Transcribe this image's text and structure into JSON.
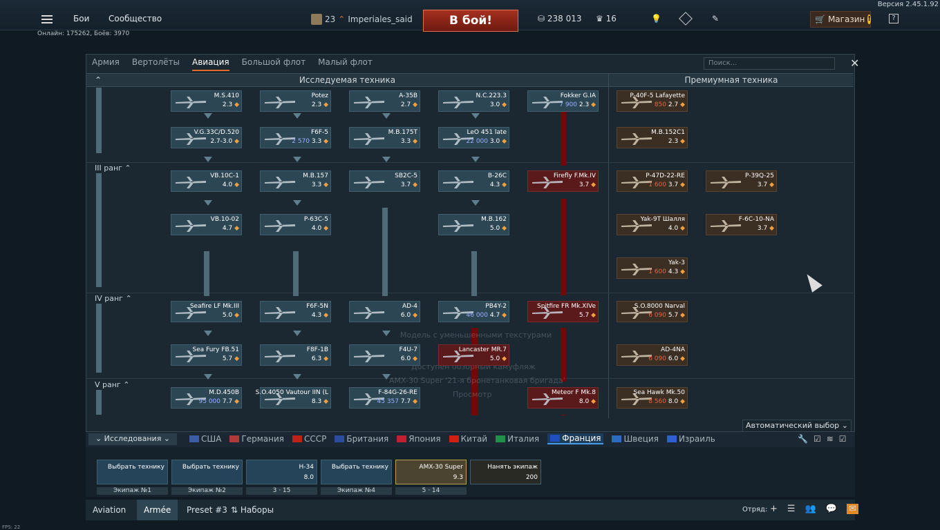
{
  "version": "Версия 2.45.1.92",
  "top": {
    "battles": "Бои",
    "community": "Сообщество",
    "player_level": "23",
    "player_name": "Imperiales_said",
    "fight_button": "В бой!",
    "silver_lions": "238 013",
    "gold_eagles": "16",
    "shop": "Магазин",
    "help": "?"
  },
  "online_info": "Онлайн: 175262, Боёв: 3970",
  "tabs": [
    "Армия",
    "Вертолёты",
    "Авиация",
    "Большой флот",
    "Малый флот"
  ],
  "search_placeholder": "Поиск...",
  "sections": {
    "researchable": "Исследуемая техника",
    "premium": "Премиумная техника"
  },
  "ranks": {
    "r3": "III ранг",
    "r4": "IV ранг",
    "r5": "V ранг"
  },
  "vehicles": [
    {
      "name": "M.S.410",
      "br": "2.3",
      "extra": ""
    },
    {
      "name": "Potez",
      "br": "2.3",
      "extra": ""
    },
    {
      "name": "A-35B",
      "br": "2.7",
      "extra": ""
    },
    {
      "name": "N.C.223.3",
      "br": "3.0",
      "extra": ""
    },
    {
      "name": "Fokker G.IA",
      "br": "2.3",
      "extra": "7 900"
    },
    {
      "name": "V.G.33C/D.520",
      "br": "2.7-3.0",
      "extra": ""
    },
    {
      "name": "F6F-5",
      "br": "3.3",
      "extra": "2 570"
    },
    {
      "name": "M.B.175T",
      "br": "3.3",
      "extra": ""
    },
    {
      "name": "LeO 451 late",
      "br": "3.0",
      "extra": "22 000"
    },
    {
      "name": "VB.10C-1",
      "br": "4.0",
      "extra": ""
    },
    {
      "name": "M.B.157",
      "br": "3.3",
      "extra": ""
    },
    {
      "name": "SB2C-5",
      "br": "3.7",
      "extra": ""
    },
    {
      "name": "B-26C",
      "br": "4.3",
      "extra": ""
    },
    {
      "name": "Firefly F.Mk.IV",
      "br": "3.7",
      "extra": ""
    },
    {
      "name": "VB.10-02",
      "br": "4.7",
      "extra": ""
    },
    {
      "name": "P-63C-5",
      "br": "4.0",
      "extra": ""
    },
    {
      "name": "M.B.162",
      "br": "5.0",
      "extra": ""
    },
    {
      "name": "Seafire LF Mk.III",
      "br": "5.0",
      "extra": ""
    },
    {
      "name": "F6F-5N",
      "br": "4.3",
      "extra": ""
    },
    {
      "name": "AD-4",
      "br": "6.0",
      "extra": ""
    },
    {
      "name": "PB4Y-2",
      "br": "4.7",
      "extra": "46 000"
    },
    {
      "name": "Spitfire FR Mk.XIVe",
      "br": "5.7",
      "extra": ""
    },
    {
      "name": "Sea Fury FB.51",
      "br": "5.7",
      "extra": ""
    },
    {
      "name": "F8F-1B",
      "br": "6.3",
      "extra": ""
    },
    {
      "name": "F4U-7",
      "br": "6.0",
      "extra": ""
    },
    {
      "name": "Lancaster MR.7",
      "br": "5.0",
      "extra": ""
    },
    {
      "name": "M.D.450B",
      "br": "7.7",
      "extra": "95 000"
    },
    {
      "name": "S.O.4050 Vautour IIN (L",
      "br": "8.3",
      "extra": ""
    },
    {
      "name": "F-84G-26-RE",
      "br": "7.7",
      "extra": "45 357"
    },
    {
      "name": "Meteor F Mk.8",
      "br": "8.0",
      "extra": ""
    }
  ],
  "premium": [
    {
      "name": "P-40F-5 Lafayette",
      "br": "2.7",
      "extra": "850"
    },
    {
      "name": "M.B.152C1",
      "br": "2.3",
      "extra": ""
    },
    {
      "name": "P-47D-22-RE",
      "br": "3.7",
      "extra": "1 600"
    },
    {
      "name": "P-39Q-25",
      "br": "3.7",
      "extra": ""
    },
    {
      "name": "Yak-9T Шалля",
      "br": "4.0",
      "extra": ""
    },
    {
      "name": "F-6C-10-NA",
      "br": "3.7",
      "extra": ""
    },
    {
      "name": "Yak-3",
      "br": "4.3",
      "extra": "1 600"
    },
    {
      "name": "S.O.8000 Narval",
      "br": "5.7",
      "extra": "6 090"
    },
    {
      "name": "AD-4NA",
      "br": "6.0",
      "extra": "6 090"
    },
    {
      "name": "Sea Hawk Mk.50",
      "br": "8.0",
      "extra": "8 560"
    }
  ],
  "ghost_text": [
    "Модель с уменьшенными текстурами",
    "Доступен обзорный камуфляж",
    "AMX-30 Super '21-я бронетанковая бригада'",
    "Просмотр"
  ],
  "auto_select": "Автоматический выбор",
  "research_button": "Исследования",
  "nations": [
    "США",
    "Германия",
    "СССР",
    "Британия",
    "Япония",
    "Китай",
    "Италия",
    "Франция",
    "Швеция",
    "Израиль"
  ],
  "crew": [
    {
      "title": "Выбрать технику",
      "sub": "",
      "label": "Экипаж №1"
    },
    {
      "title": "Выбрать технику",
      "sub": "",
      "label": "Экипаж №2"
    },
    {
      "title": "H-34",
      "sub": "8.0",
      "label": "3 · 15"
    },
    {
      "title": "Выбрать технику",
      "sub": "",
      "label": "Экипаж №4"
    },
    {
      "title": "AMX-30 Super",
      "sub": "9.3",
      "label": "5 · 14"
    },
    {
      "title": "Нанять экипаж",
      "sub": "200",
      "label": ""
    }
  ],
  "presets": [
    "Aviation",
    "Armée",
    "Preset #3",
    "Наборы"
  ],
  "squad": "Отряд:",
  "fps": "FPS: 22",
  "colors": {
    "accent": "#e06a2a",
    "fight": "#a63020",
    "active_nation": "#1c3c5c"
  }
}
